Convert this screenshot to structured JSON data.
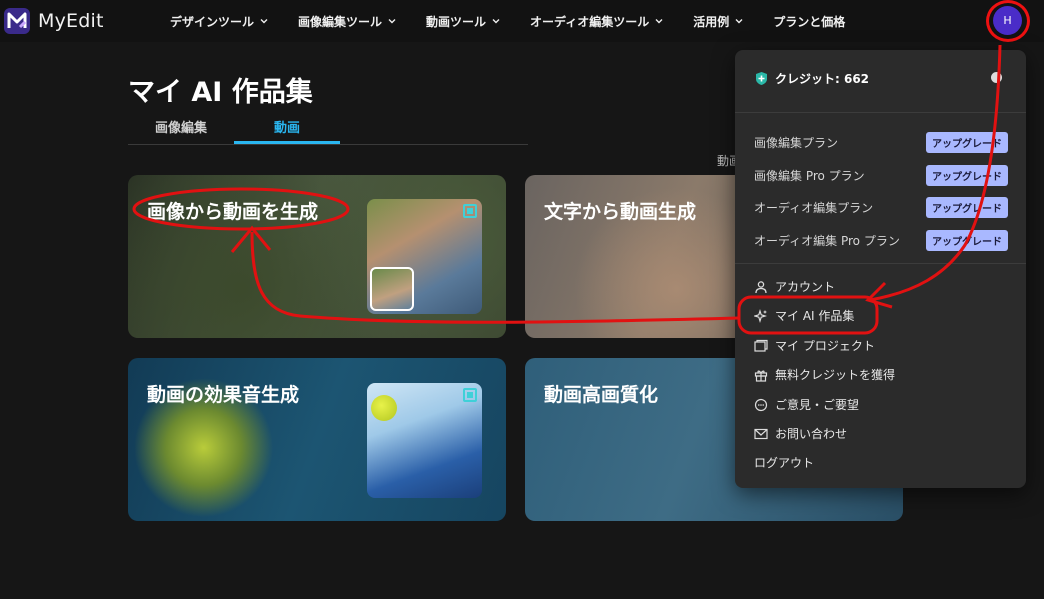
{
  "app": {
    "name": "MyEdit"
  },
  "nav": {
    "items": [
      {
        "label": "デザインツール",
        "has_dropdown": true
      },
      {
        "label": "画像編集ツール",
        "has_dropdown": true
      },
      {
        "label": "動画ツール",
        "has_dropdown": true
      },
      {
        "label": "オーディオ編集ツール",
        "has_dropdown": true
      },
      {
        "label": "活用例",
        "has_dropdown": true
      },
      {
        "label": "プランと価格",
        "has_dropdown": false
      }
    ],
    "avatar_initial": "H"
  },
  "page": {
    "title": "マイ AI 作品集",
    "tabs": [
      {
        "label": "画像編集",
        "active": false
      },
      {
        "label": "動画",
        "active": true
      }
    ],
    "sort_label": "動画"
  },
  "cards": [
    {
      "title": "画像から動画を生成"
    },
    {
      "title": "文字から動画生成"
    },
    {
      "title": "動画の効果音生成"
    },
    {
      "title": "動画高画質化"
    }
  ],
  "menu": {
    "credits": "クレジット: 662",
    "plans": [
      {
        "label": "画像編集プラン",
        "button": "アップグレード"
      },
      {
        "label": "画像編集 Pro プラン",
        "button": "アップグレード"
      },
      {
        "label": "オーディオ編集プラン",
        "button": "アップグレード"
      },
      {
        "label": "オーディオ編集 Pro プラン",
        "button": "アップグレード"
      }
    ],
    "items": [
      {
        "label": "アカウント",
        "icon": "user-icon"
      },
      {
        "label": "マイ AI 作品集",
        "icon": "sparkle-icon"
      },
      {
        "label": "マイ プロジェクト",
        "icon": "folder-icon"
      },
      {
        "label": "無料クレジットを獲得",
        "icon": "gift-icon"
      },
      {
        "label": "ご意見・ご要望",
        "icon": "chat-icon"
      },
      {
        "label": "お問い合わせ",
        "icon": "mail-icon"
      },
      {
        "label": "ログアウト",
        "icon": ""
      }
    ]
  },
  "colors": {
    "accent": "#2ab6f0",
    "upgrade_bg": "#a9b8ff",
    "avatar": "#4a2cc8",
    "annotation": "#e11111"
  }
}
